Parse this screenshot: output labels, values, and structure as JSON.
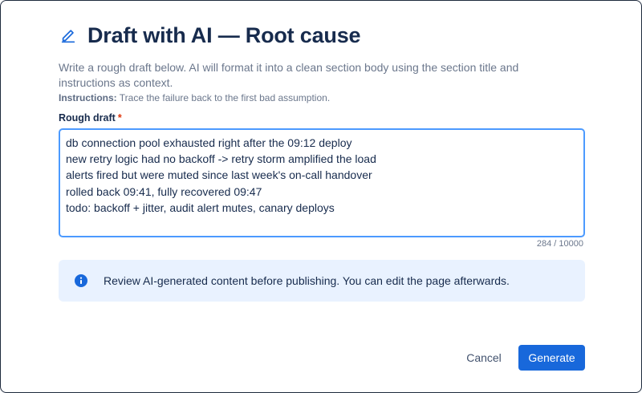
{
  "dialog": {
    "title": "Draft with AI — Root cause",
    "title_icon": "pencil-icon",
    "description": "Write a rough draft below. AI will format it into a clean section body using the section title and instructions as context.",
    "instructions_label": "Instructions:",
    "instructions_text": "Trace the failure back to the first bad assumption.",
    "field_label": "Rough draft",
    "required_marker": "*",
    "draft_lines": [
      "db connection pool exhausted right after the 09:12 deploy",
      "new retry logic had no backoff -> retry storm amplified the load",
      "alerts fired but were muted since last week's on-call handover",
      "rolled back 09:41, fully recovered 09:47",
      "todo: backoff + jitter, audit alert mutes, canary deploys"
    ],
    "char_count": "284 / 10000",
    "info": {
      "icon": "info-icon",
      "text": "Review AI-generated content before publishing. You can edit the page afterwards."
    },
    "buttons": {
      "cancel": "Cancel",
      "generate": "Generate"
    }
  },
  "colors": {
    "title": "#172b4d",
    "muted": "#6b778c",
    "focus_border": "#4c9aff",
    "info_bg": "#e9f2ff",
    "info_icon": "#1868db",
    "primary": "#1868db",
    "required": "#de350b"
  }
}
